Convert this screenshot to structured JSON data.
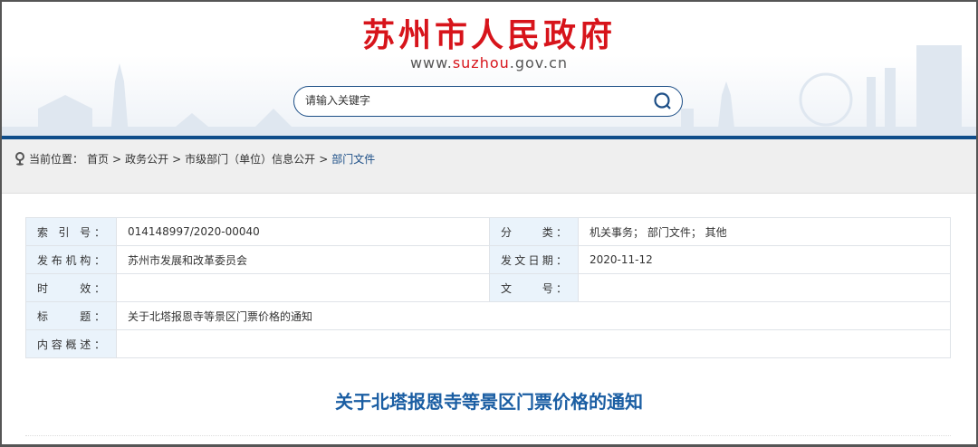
{
  "header": {
    "logo": "苏州市人民政府",
    "url_prefix": "www.",
    "url_highlight": "suzhou",
    "url_suffix": ".gov.cn",
    "search_placeholder": "请输入关键字"
  },
  "breadcrumb": {
    "label": "当前位置：",
    "items": [
      "首页",
      "政务公开",
      "市级部门（单位）信息公开"
    ],
    "current": "部门文件",
    "separator": ">"
  },
  "info": {
    "index_label": "索 引 号：",
    "index_value": "014148997/2020-00040",
    "category_label": "分　　类：",
    "category_value": "机关事务； 部门文件； 其他",
    "publisher_label": "发布机构：",
    "publisher_value": "苏州市发展和改革委员会",
    "date_label": "发文日期：",
    "date_value": "2020-11-12",
    "validity_label": "时　　效：",
    "validity_value": "",
    "docno_label": "文　　号：",
    "docno_value": "",
    "title_label": "标　　题：",
    "title_value": "关于北塔报恩寺等景区门票价格的通知",
    "summary_label": "内容概述：",
    "summary_value": ""
  },
  "article": {
    "title": "关于北塔报恩寺等景区门票价格的通知"
  },
  "colors": {
    "brand_red": "#d7141b",
    "brand_blue": "#0e4d8a",
    "title_blue": "#1b5ea3"
  }
}
